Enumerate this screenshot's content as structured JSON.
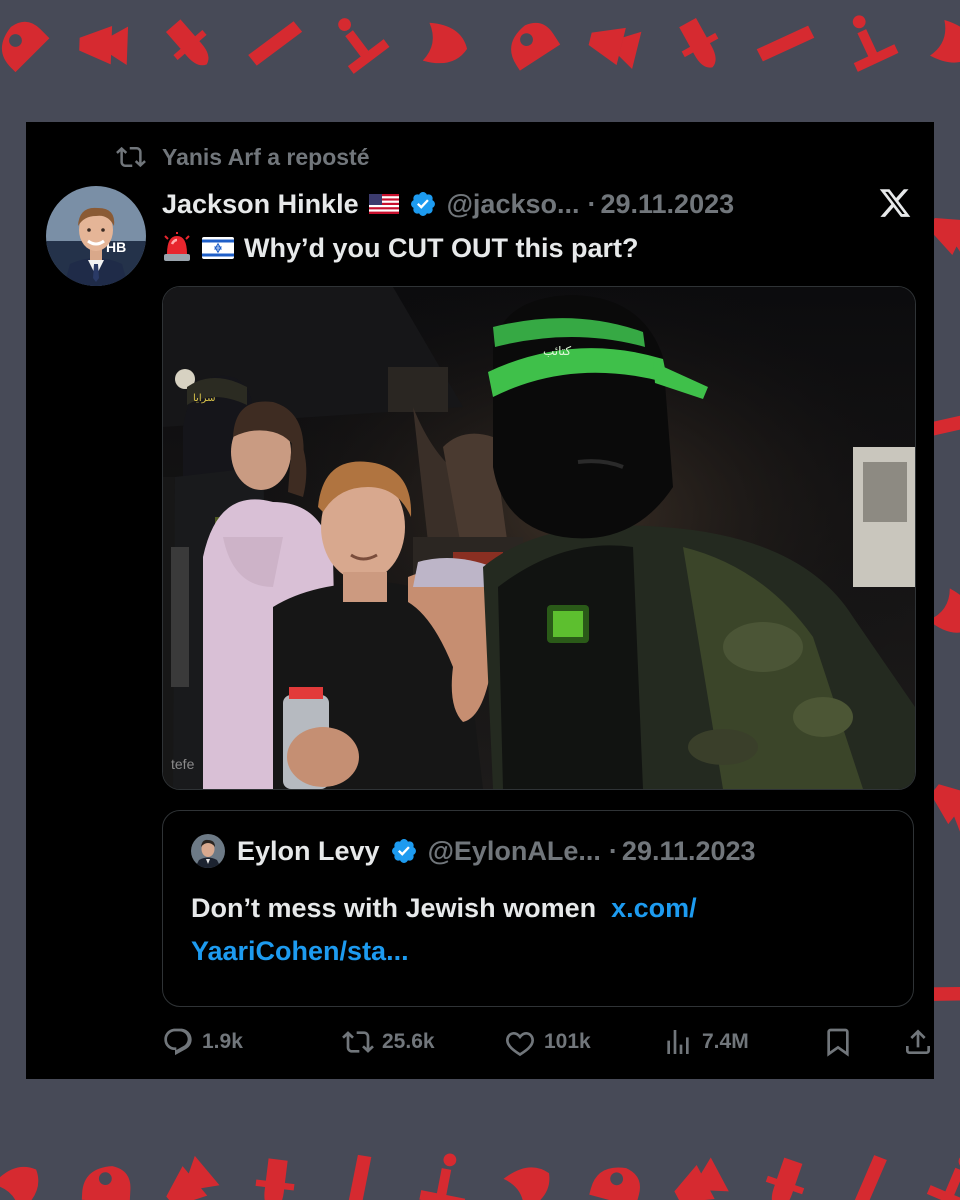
{
  "repost": {
    "text": "Yanis Arf a reposté"
  },
  "tweet": {
    "name": "Jackson Hinkle",
    "handle": "@jackso...",
    "separator": "·",
    "date": "29.11.2023",
    "text": "Why’d you CUT OUT this part?",
    "emoji": [
      "police-light-emoji",
      "israel-flag-emoji"
    ],
    "name_flag": "us-flag-emoji",
    "media_watermark": "tefe"
  },
  "quote": {
    "name": "Eylon Levy",
    "handle": "@EylonALe...",
    "separator": "·",
    "date": "29.11.2023",
    "text": "Don’t mess with Jewish women",
    "link_line1": "x.com/",
    "link_line2": "YaariCohen/sta..."
  },
  "actions": {
    "replies": "1.9k",
    "reposts": "25.6k",
    "likes": "101k",
    "views": "7.4M"
  },
  "colors": {
    "background": "#474a57",
    "pattern": "#d62a30",
    "card": "#000000",
    "text_primary": "#e7e9ea",
    "text_secondary": "#71767b",
    "link": "#1d9bf0",
    "verified": "#1d9bf0"
  }
}
